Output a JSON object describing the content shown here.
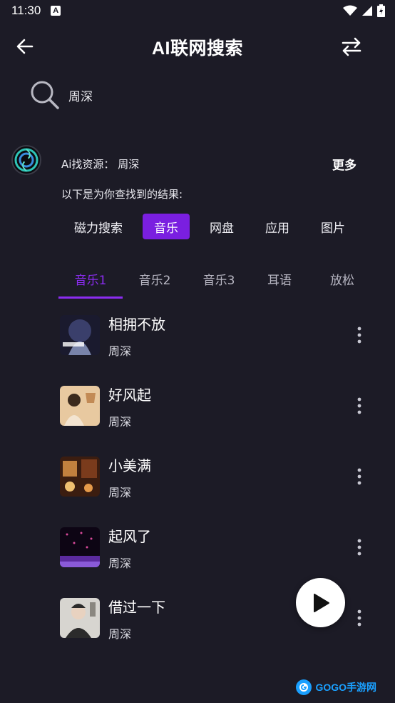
{
  "status_bar": {
    "time": "11:30",
    "notification_badge": "A"
  },
  "header": {
    "title": "AI联网搜索"
  },
  "search": {
    "query": "周深"
  },
  "ai_result": {
    "source_label": "Ai找资源：  周深",
    "more_label": "更多",
    "intro": "以下是为你查找到的结果:"
  },
  "categories": [
    {
      "label": "磁力搜索",
      "active": false
    },
    {
      "label": "音乐",
      "active": true
    },
    {
      "label": "网盘",
      "active": false
    },
    {
      "label": "应用",
      "active": false
    },
    {
      "label": "图片",
      "active": false
    }
  ],
  "tabs": [
    {
      "label": "音乐1",
      "active": true
    },
    {
      "label": "音乐2",
      "active": false
    },
    {
      "label": "音乐3",
      "active": false
    },
    {
      "label": "耳语",
      "active": false
    },
    {
      "label": "放松",
      "active": false
    }
  ],
  "songs": [
    {
      "title": "相拥不放",
      "artist": "周深",
      "cover_colors": [
        "#3a3f6b",
        "#a3b2e0",
        "#1a1a2e"
      ]
    },
    {
      "title": "好风起",
      "artist": "周深",
      "cover_colors": [
        "#e8c9a0",
        "#f3e4d0",
        "#c28a55"
      ]
    },
    {
      "title": "小美满",
      "artist": "周深",
      "cover_colors": [
        "#7a3b1c",
        "#e59a4a",
        "#3b1d10"
      ]
    },
    {
      "title": "起风了",
      "artist": "周深",
      "cover_colors": [
        "#0d0514",
        "#d94a9b",
        "#5b2a9e"
      ]
    },
    {
      "title": "借过一下",
      "artist": "周深",
      "cover_colors": [
        "#d7d5d0",
        "#2b2b2b",
        "#8a8780"
      ]
    }
  ],
  "watermark": {
    "text": "GOGO手游网"
  },
  "colors": {
    "accent": "#7a1fe0",
    "tab_active": "#8b2cf0",
    "background": "#1c1b26"
  }
}
